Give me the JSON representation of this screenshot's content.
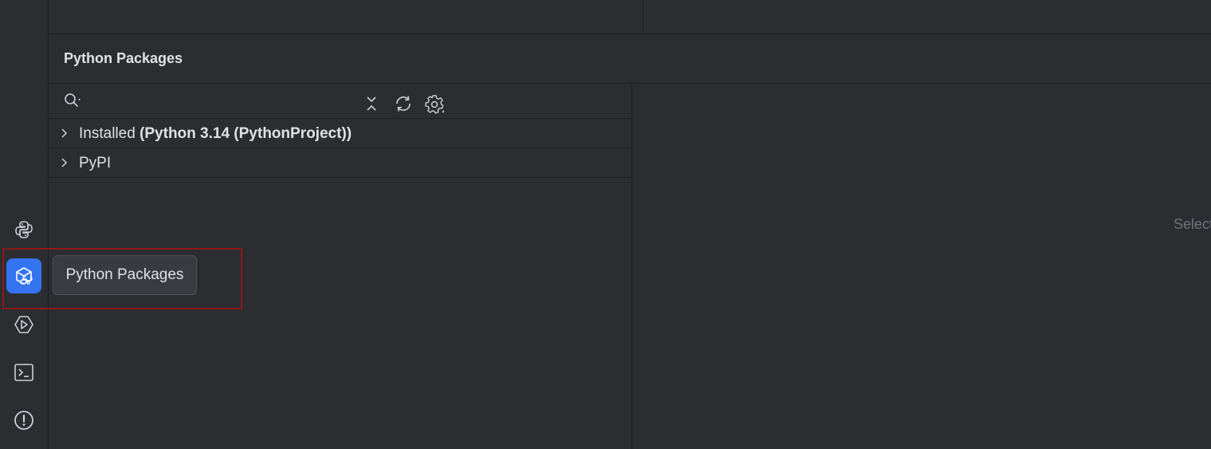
{
  "panel": {
    "title": "Python Packages"
  },
  "search": {
    "placeholder": "",
    "value": ""
  },
  "tree": {
    "installed_prefix": "Installed ",
    "installed_interpreter": "(Python 3.14 (PythonProject))",
    "pypi_label": "PyPI"
  },
  "detail": {
    "empty_text": "Select"
  },
  "tooltip": {
    "text": "Python Packages"
  },
  "toolstrip": {
    "items": [
      "python-console-icon",
      "python-packages-icon",
      "services-icon",
      "terminal-icon",
      "problems-icon"
    ],
    "active": "python-packages-icon"
  },
  "colors": {
    "background": "#2b2d30",
    "accent": "#3574f0",
    "border": "#1e1f22",
    "text": "#dfe1e5",
    "muted": "#6f737a",
    "highlight": "#8b1a1a"
  }
}
